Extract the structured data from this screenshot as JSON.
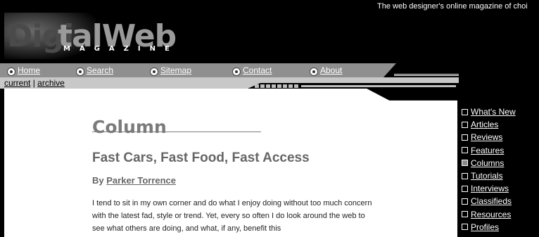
{
  "header": {
    "tagline": "The web designer's online magazine of choi",
    "logo_digi": "Digi",
    "logo_web": "talWeb",
    "logo_magazine": "MAGAZINE"
  },
  "nav": [
    {
      "label": "Home",
      "icon": "home-icon"
    },
    {
      "label": "Search",
      "icon": "search-icon"
    },
    {
      "label": "Sitemap",
      "icon": "sitemap-icon"
    },
    {
      "label": "Contact",
      "icon": "contact-icon"
    },
    {
      "label": "About",
      "icon": "about-icon"
    }
  ],
  "subnav": {
    "current": "current",
    "separator": "|",
    "archive": "archive"
  },
  "article": {
    "section": "Column",
    "title": "Fast Cars, Fast Food, Fast Access",
    "by": "By",
    "author": "Parker Torrence",
    "body": "I tend to sit in my own corner and do what I enjoy doing without too much concern with the latest fad, style or trend. Yet, every so often I do look around the web to see what others are doing, and what, if any, benefit this"
  },
  "sidebar": {
    "items": [
      {
        "label": "What's New",
        "active": false
      },
      {
        "label": "Articles",
        "active": false
      },
      {
        "label": "Reviews",
        "active": false
      },
      {
        "label": "Features",
        "active": false
      },
      {
        "label": "Columns",
        "active": true
      },
      {
        "label": "Tutorials",
        "active": false
      },
      {
        "label": "Interviews",
        "active": false
      },
      {
        "label": "Classifieds",
        "active": false
      },
      {
        "label": "Resources",
        "active": false
      },
      {
        "label": "Profiles",
        "active": false
      }
    ]
  },
  "colors": {
    "background": "#000000",
    "navbar": "#8f8f8f",
    "subbar": "#c8c8c8",
    "heading_gray": "#7b7b7b"
  }
}
